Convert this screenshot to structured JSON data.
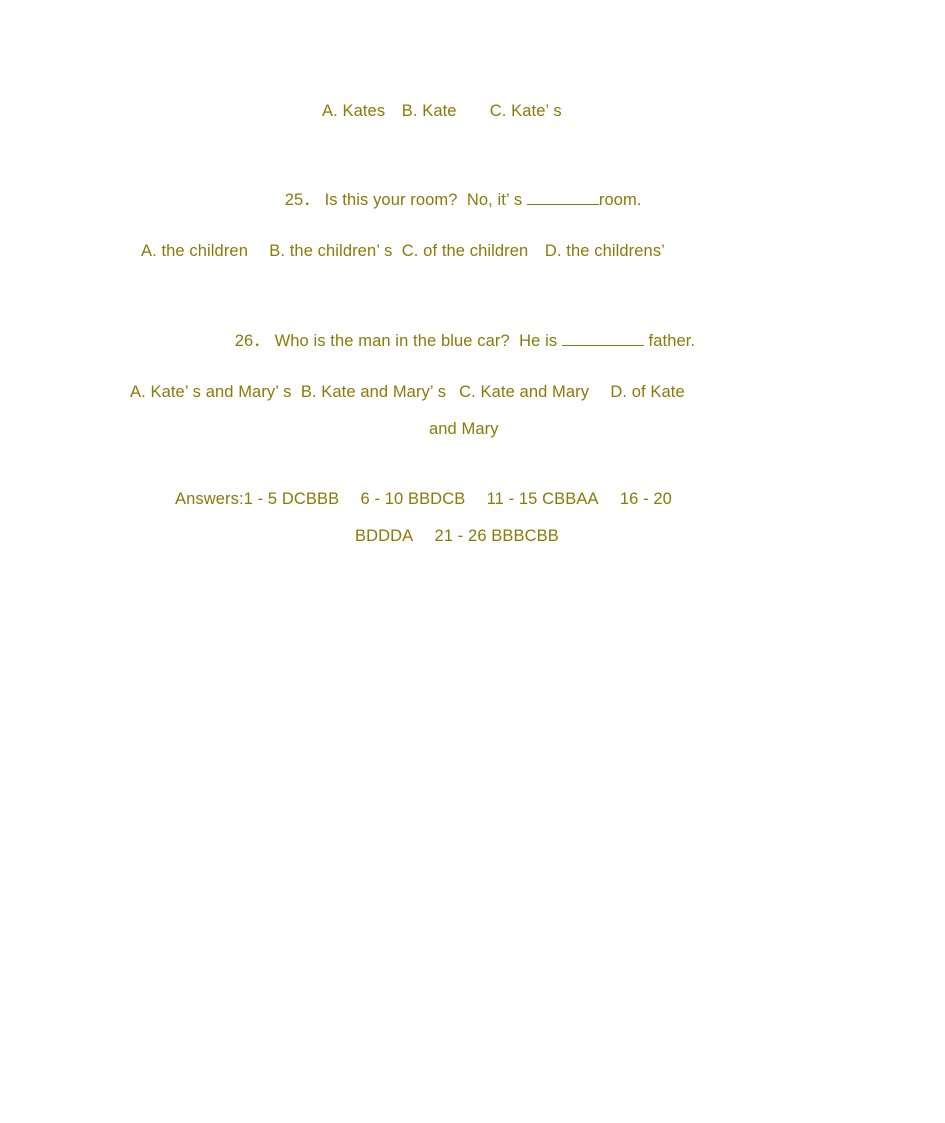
{
  "document": {
    "text_color": "#8a7a08",
    "background_color": "#ffffff",
    "lines": {
      "q24_options": "A. Kates B. Kate  C. Kate’ s",
      "q25_stem_before_blank": "25． Is this your room?  No, it’ s ",
      "q25_stem_after_blank": "room.",
      "q25_options": "A. the children  B. the children’ s  C. of the children D. the childrens’",
      "q26_stem_before_blank": "26． Who is the man in the blue car?  He is ",
      "q26_stem_after_blank": " father.",
      "q26_options": "A. Kate’ s and Mary’ s  B. Kate and Mary’ s  C. Kate and Mary  D. of Kate",
      "q26_options_wrap": "and Mary",
      "answers_line1": "Answers:1 - 5 DCBBB  6 - 10 BBDCB  11 - 15 CBBAA  16 - 20",
      "answers_line2": "BDDDA  21 - 26 BBBCBB"
    }
  }
}
